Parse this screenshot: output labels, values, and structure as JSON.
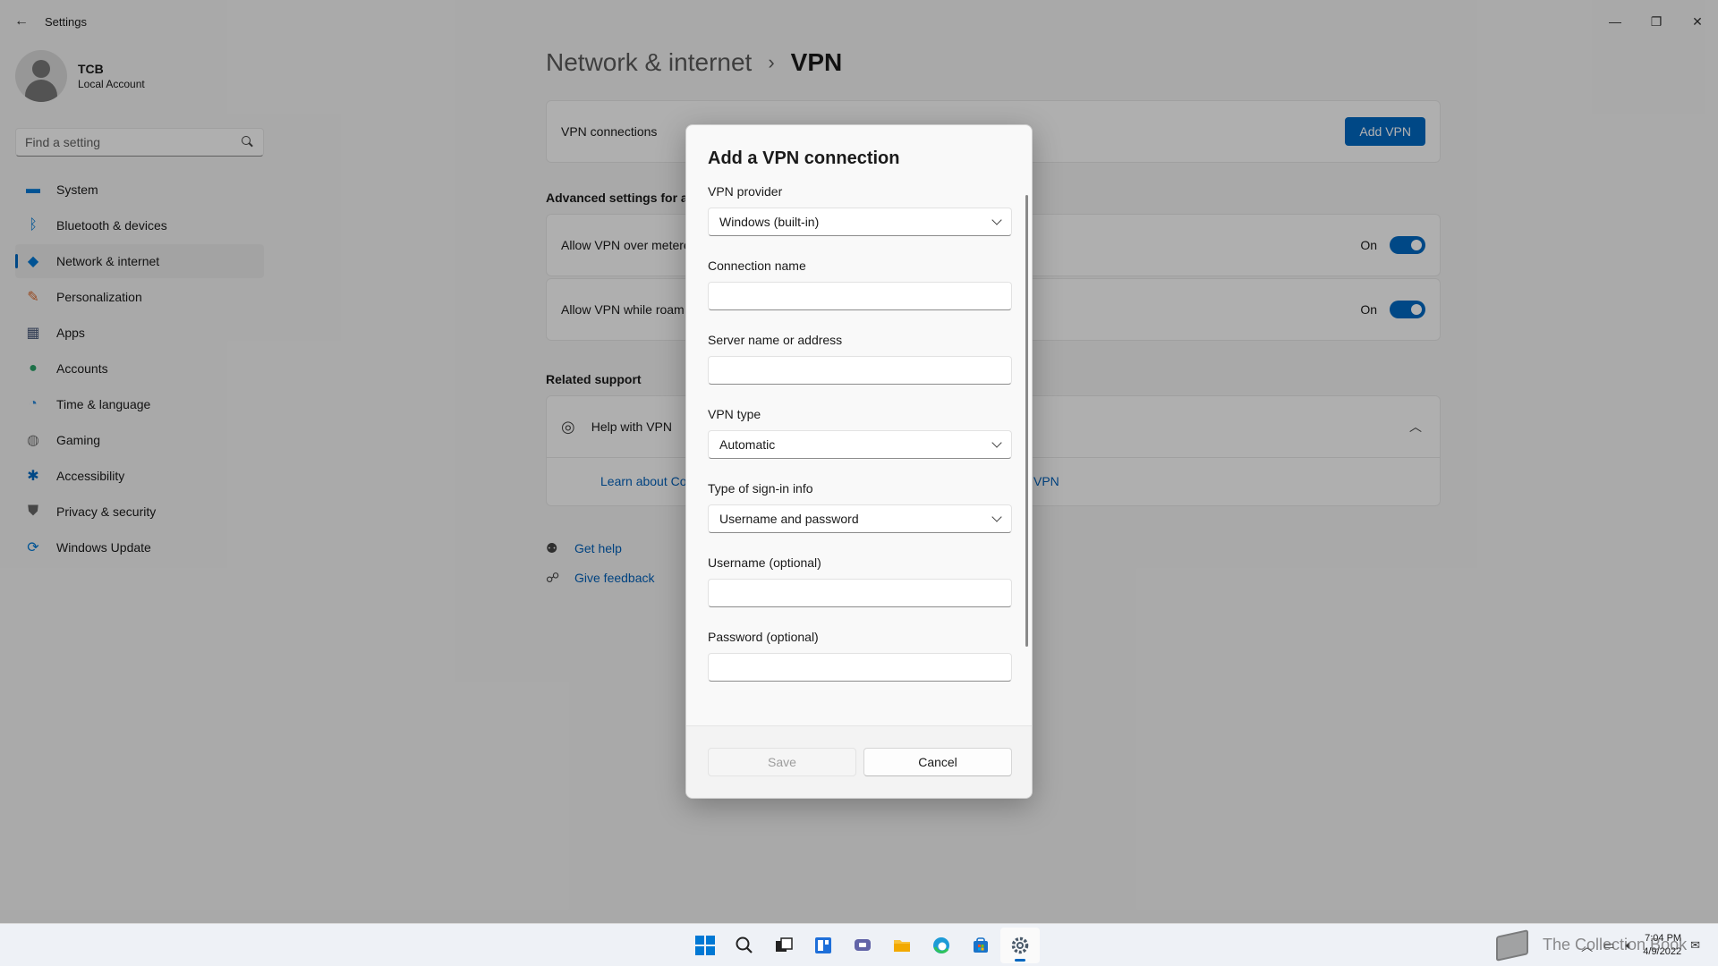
{
  "window": {
    "title": "Settings",
    "back_glyph": "←",
    "minimize": "—",
    "maximize": "❐",
    "close": "✕"
  },
  "profile": {
    "name": "TCB",
    "account_type": "Local Account"
  },
  "search": {
    "placeholder": "Find a setting"
  },
  "sidebar": {
    "items": [
      {
        "label": "System",
        "icon": "system-icon",
        "glyph": "▬",
        "color": "#0078d4"
      },
      {
        "label": "Bluetooth & devices",
        "icon": "bluetooth-icon",
        "glyph": "ᛒ",
        "color": "#0078d4"
      },
      {
        "label": "Network & internet",
        "icon": "wifi-icon",
        "glyph": "◆",
        "color": "#0078d4",
        "active": true
      },
      {
        "label": "Personalization",
        "icon": "brush-icon",
        "glyph": "✎",
        "color": "#d9672c"
      },
      {
        "label": "Apps",
        "icon": "apps-icon",
        "glyph": "▦",
        "color": "#4a5a7a"
      },
      {
        "label": "Accounts",
        "icon": "accounts-icon",
        "glyph": "●",
        "color": "#2aa167"
      },
      {
        "label": "Time & language",
        "icon": "globe-clock-icon",
        "glyph": "◔",
        "color": "#2b88d8"
      },
      {
        "label": "Gaming",
        "icon": "gamepad-icon",
        "glyph": "◍",
        "color": "#777777"
      },
      {
        "label": "Accessibility",
        "icon": "accessibility-icon",
        "glyph": "✱",
        "color": "#0067c0"
      },
      {
        "label": "Privacy & security",
        "icon": "shield-icon",
        "glyph": "⛊",
        "color": "#666666"
      },
      {
        "label": "Windows Update",
        "icon": "update-icon",
        "glyph": "⟳",
        "color": "#0078d4"
      }
    ]
  },
  "breadcrumb": {
    "parent": "Network & internet",
    "separator": "›",
    "current": "VPN"
  },
  "vpn": {
    "connections_label": "VPN connections",
    "add_button": "Add VPN",
    "advanced_heading": "Advanced settings for al",
    "metered": {
      "label": "Allow VPN over metere",
      "state": "On"
    },
    "roaming": {
      "label": "Allow VPN while roam",
      "state": "On"
    },
    "related_heading": "Related support",
    "help_label": "Help with VPN",
    "help_link_left": "Learn about Co",
    "help_link_right": "VPN",
    "get_help": "Get help",
    "give_feedback": "Give feedback"
  },
  "dialog": {
    "title": "Add a VPN connection",
    "provider_label": "VPN provider",
    "provider_value": "Windows (built-in)",
    "connection_name_label": "Connection name",
    "connection_name_value": "",
    "server_label": "Server name or address",
    "server_value": "",
    "vpn_type_label": "VPN type",
    "vpn_type_value": "Automatic",
    "signin_type_label": "Type of sign-in info",
    "signin_type_value": "Username and password",
    "username_label": "Username (optional)",
    "username_value": "",
    "password_label": "Password (optional)",
    "password_value": "",
    "save_button": "Save",
    "cancel_button": "Cancel"
  },
  "taskbar": {
    "time": "7:04 PM",
    "date": "4/9/2022",
    "watermark": "The Collection Book"
  },
  "colors": {
    "accent": "#0067c0",
    "link": "#005fb8"
  }
}
